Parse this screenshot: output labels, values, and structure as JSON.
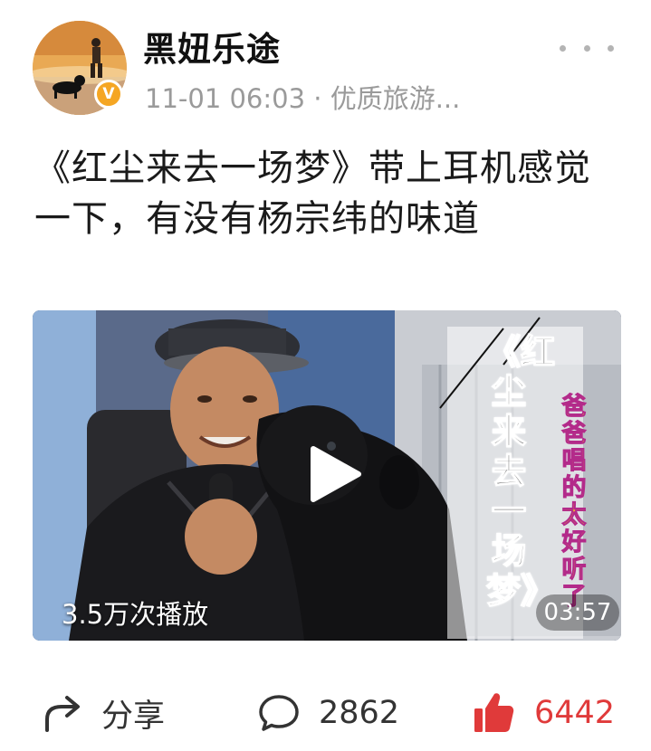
{
  "post": {
    "author": {
      "name": "黑妞乐途",
      "verified_badge": "V",
      "avatar_icon": "avatar-man-with-dog"
    },
    "meta": "11-01 06:03 · 优质旅游...",
    "more_icon": "more-dots-icon",
    "title": "《红尘来去一场梦》带上耳机感觉一下，有没有杨宗纬的味道",
    "video": {
      "cover_title": "《红尘来去一场梦》",
      "cover_subtitle": "爸爸唱的太好听了",
      "play_count": "3.5万次播放",
      "duration": "03:57",
      "play_icon": "play-icon"
    },
    "actions": {
      "share": {
        "label": "分享",
        "icon": "share-arrow-icon"
      },
      "comment": {
        "count": "2862",
        "icon": "comment-bubble-icon"
      },
      "like": {
        "count": "6442",
        "icon": "thumbs-up-icon",
        "liked": true
      }
    }
  },
  "colors": {
    "like_red": "#e03a3a",
    "meta_gray": "#9a9a9a",
    "badge_gold": "#f5a623",
    "cover_subtitle_yellow": "#f4b92a"
  }
}
